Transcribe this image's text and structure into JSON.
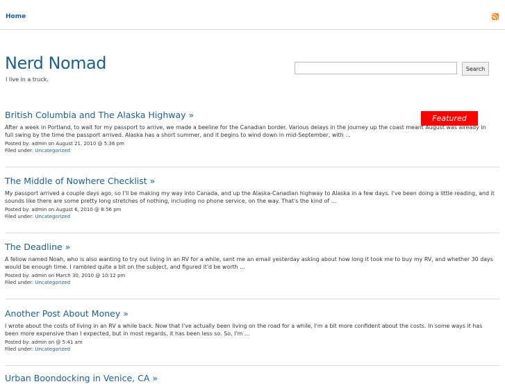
{
  "nav": {
    "home": "Home",
    "rss_icon": "rss-icon"
  },
  "site": {
    "title": "Nerd Nomad",
    "tagline": "I live in a truck."
  },
  "search": {
    "button": "Search",
    "value": ""
  },
  "featured_badge": "Featured",
  "colors": {
    "link": "#1b5f8c",
    "featured": "#ff0000",
    "rss": "#f28a1e"
  },
  "posts": [
    {
      "title": "British Columbia and The Alaska Highway »",
      "excerpt": "After a week in Portland, to wait for my passport to arrive, we made a beeline for the Canadian border. Various delays in the journey up the coast meant August was already in full swing by the time the passport arrived. Alaska has a short summer, and it begins to wind down in mid-September, with …",
      "posted": "Posted by: admin on August 21, 2010 @ 5:36 pm",
      "filed_label": "Filed under:",
      "category": "Uncategorized"
    },
    {
      "title": "The Middle of Nowhere Checklist »",
      "excerpt": "My passport arrived a couple days ago, so I'll be making my way into Canada, and up the Alaska-Canadian highway to Alaska in a few days. I've been doing a little reading, and it sounds like there are some pretty long stretches of nothing, including no phone service, on the way. That's the kind of …",
      "posted": "Posted by: admin on August 6, 2010 @ 8:56 pm",
      "filed_label": "Filed under:",
      "category": "Uncategorized"
    },
    {
      "title": "The Deadline »",
      "excerpt": "A fellow named Noah, who is also wanting to try out living in an RV for a while, sent me an email yesterday asking about how long it took me to buy my RV, and whether 30 days would be enough time. I rambled quite a bit on the subject, and figured it'd be worth …",
      "posted": "Posted by: admin on March 30, 2010 @ 10:12 pm",
      "filed_label": "Filed under:",
      "category": "Uncategorized"
    },
    {
      "title": "Another Post About Money »",
      "excerpt": "I wrote about the costs of living in an RV a while back. Now that I've actually been living on the road for a while, I'm a bit more confident about the costs. In some ways it has been more expensive than I expected, but in most regards, it has been less so. So, I'm …",
      "posted": "Posted by: admin on @ 5:41 am",
      "filed_label": "Filed under:",
      "category": "Uncategorized"
    },
    {
      "title": "Urban Boondocking in Venice, CA »"
    }
  ]
}
